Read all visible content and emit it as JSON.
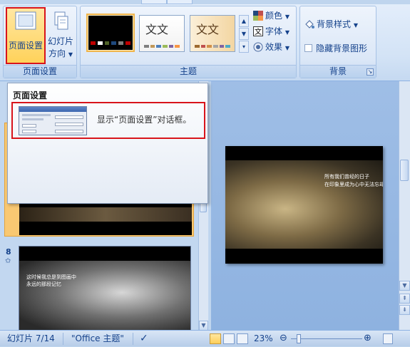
{
  "ribbon": {
    "groups": {
      "page_setup": {
        "label": "页面设置",
        "page_setup_button": "页面设置",
        "orientation_button_line1": "幻灯片",
        "orientation_button_line2": "方向"
      },
      "themes": {
        "label": "主题",
        "theme_sample_text": "文文",
        "colors_label": "颜色",
        "fonts_label": "字体",
        "effects_label": "效果"
      },
      "background": {
        "label": "背景",
        "background_styles_label": "背景样式",
        "hide_background_label": "隐藏背景图形",
        "hide_background_checked": false
      }
    }
  },
  "tooltip": {
    "title": "页面设置",
    "description": "显示“页面设置”对话框。"
  },
  "slides_pane": {
    "slide_number": "8",
    "slide8_text_line1": "这时候我总是到图画中",
    "slide8_text_line2": "永远的那段记忆"
  },
  "main_slide": {
    "text_line1": "所有我们曾经的日子",
    "text_line2": "在印象里成为心中无法忘却的画面"
  },
  "statusbar": {
    "slide_position": "幻灯片 7/14",
    "theme_name": "\"Office 主题\"",
    "zoom": "23%"
  },
  "colors": {
    "highlight_red": "#d8141b",
    "ribbon_text": "#15428b",
    "active_gold": "#ffd25a"
  }
}
